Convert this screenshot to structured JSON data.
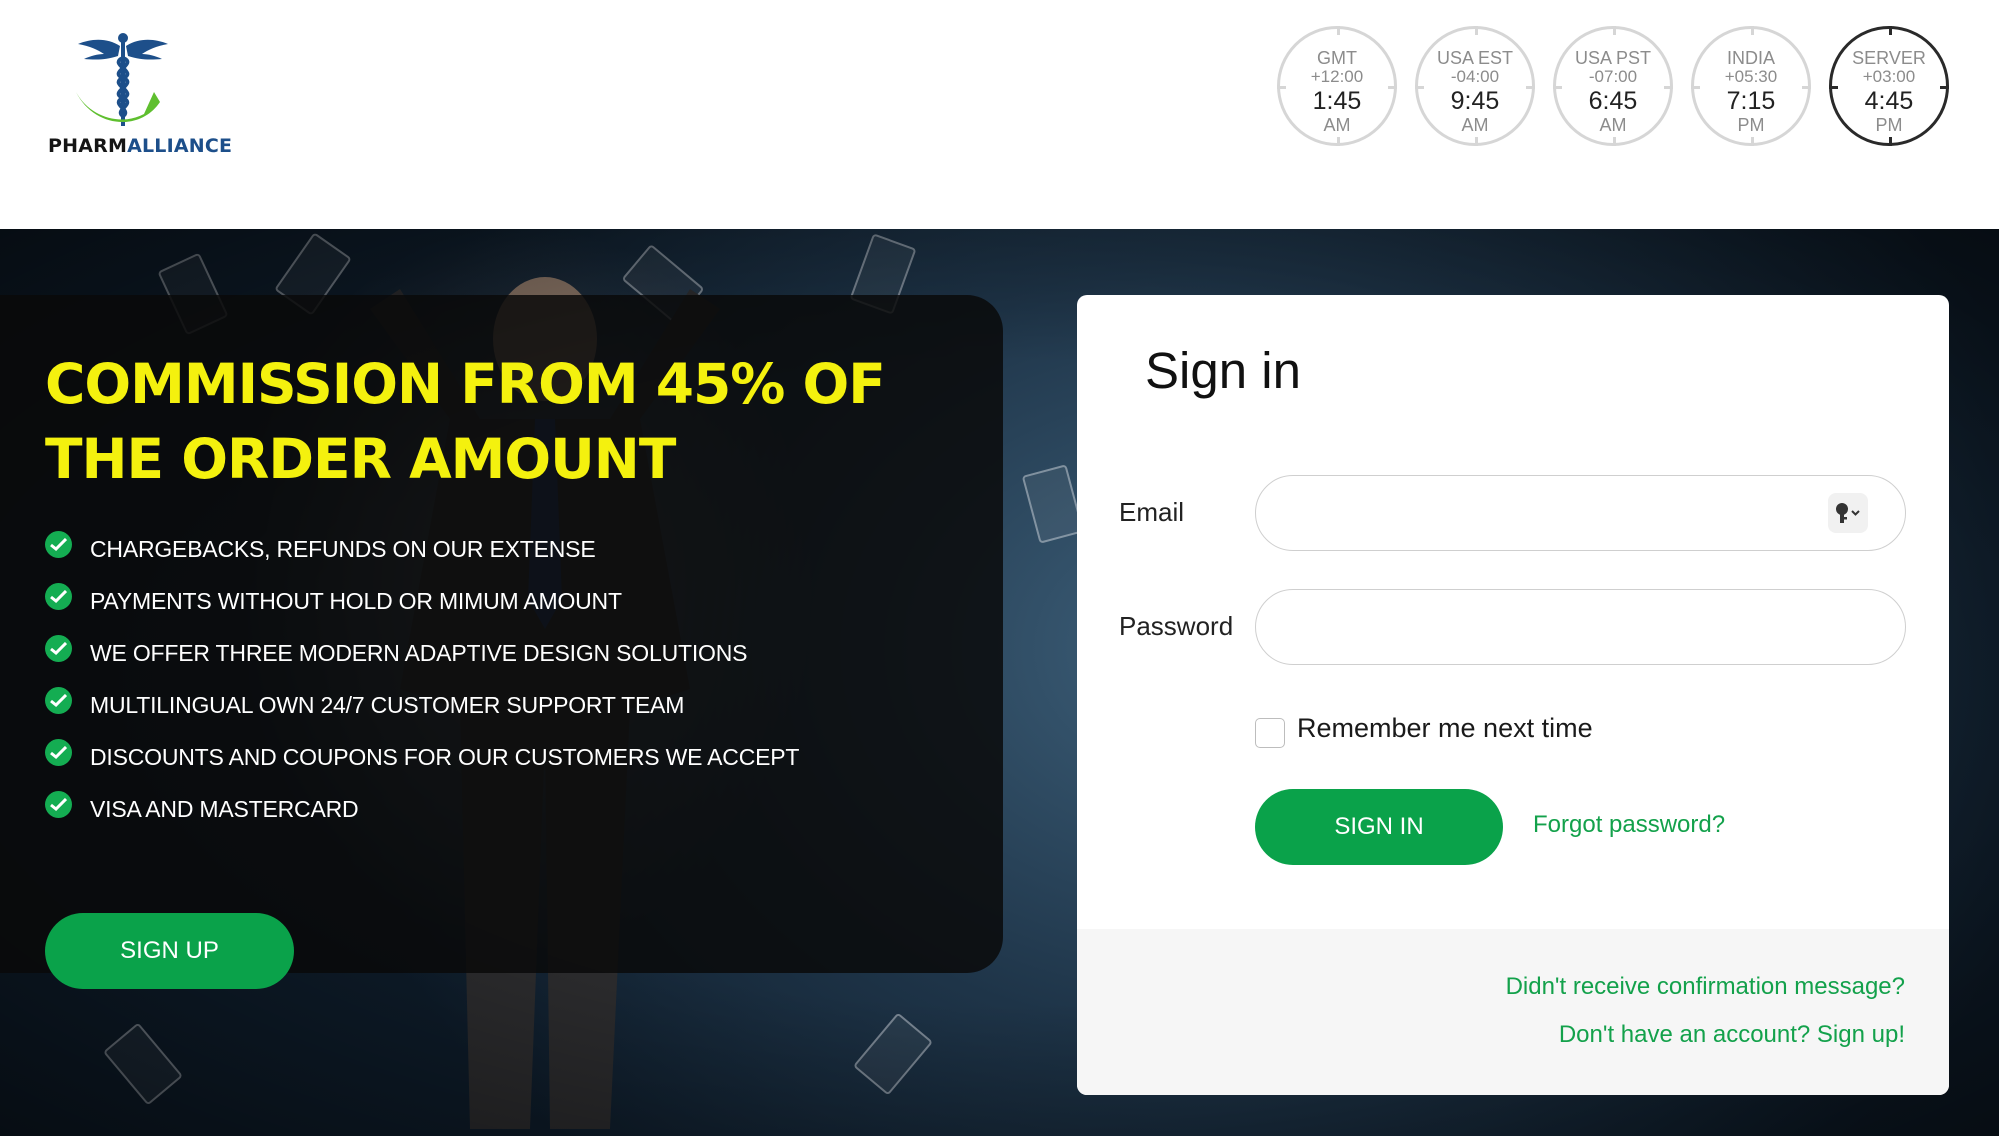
{
  "brand": {
    "name_part1": "PHARM",
    "name_part2": "ALLIANCE",
    "logo_icon": "caduceus-icon"
  },
  "clocks": [
    {
      "zone": "GMT",
      "offset": "+12:00",
      "time": "1:45",
      "ampm": "AM"
    },
    {
      "zone": "USA EST",
      "offset": "-04:00",
      "time": "9:45",
      "ampm": "AM"
    },
    {
      "zone": "USA PST",
      "offset": "-07:00",
      "time": "6:45",
      "ampm": "AM"
    },
    {
      "zone": "INDIA",
      "offset": "+05:30",
      "time": "7:15",
      "ampm": "PM"
    },
    {
      "zone": "SERVER",
      "offset": "+03:00",
      "time": "4:45",
      "ampm": "PM"
    }
  ],
  "promo": {
    "title_line1": "COMMISSION FROM 45% OF",
    "title_line2": "THE ORDER AMOUNT",
    "features": [
      "CHARGEBACKS, REFUNDS ON OUR EXTENSE",
      "PAYMENTS WITHOUT HOLD OR MIMUM AMOUNT",
      "WE OFFER THREE MODERN ADAPTIVE DESIGN SOLUTIONS",
      "MULTILINGUAL OWN 24/7 CUSTOMER SUPPORT TEAM",
      "DISCOUNTS AND COUPONS FOR OUR CUSTOMERS WE ACCEPT",
      "VISA AND MASTERCARD"
    ],
    "signup_label": "SIGN UP"
  },
  "signin": {
    "title": "Sign in",
    "email_label": "Email",
    "email_value": "",
    "password_label": "Password",
    "password_value": "",
    "remember_label": "Remember me next time",
    "remember_checked": false,
    "submit_label": "SIGN IN",
    "forgot_label": "Forgot password?",
    "resend_label": "Didn't receive confirmation message?",
    "signup_link_label": "Don't have an account? Sign up!"
  },
  "colors": {
    "accent_green": "#0aa24a",
    "title_yellow": "#f4f10e",
    "brand_blue": "#1d4f8a"
  }
}
